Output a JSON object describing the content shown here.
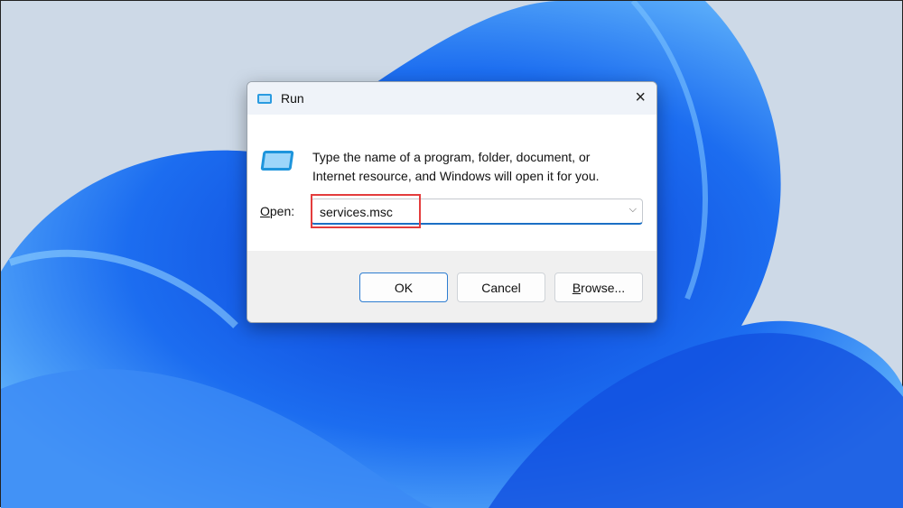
{
  "dialog": {
    "title": "Run",
    "close_icon": "×",
    "message_line1": "Type the name of a program, folder, document, or",
    "message_line2": "Internet resource, and Windows will open it for you.",
    "open_label_u": "O",
    "open_label_rest": "pen:",
    "input_value": "services.msc",
    "dropdown_icon": "⌵"
  },
  "buttons": {
    "ok": "OK",
    "cancel": "Cancel",
    "browse_u": "B",
    "browse_rest": "rowse..."
  },
  "colors": {
    "highlight": "#e43d3d",
    "accent": "#1b6fc5"
  }
}
